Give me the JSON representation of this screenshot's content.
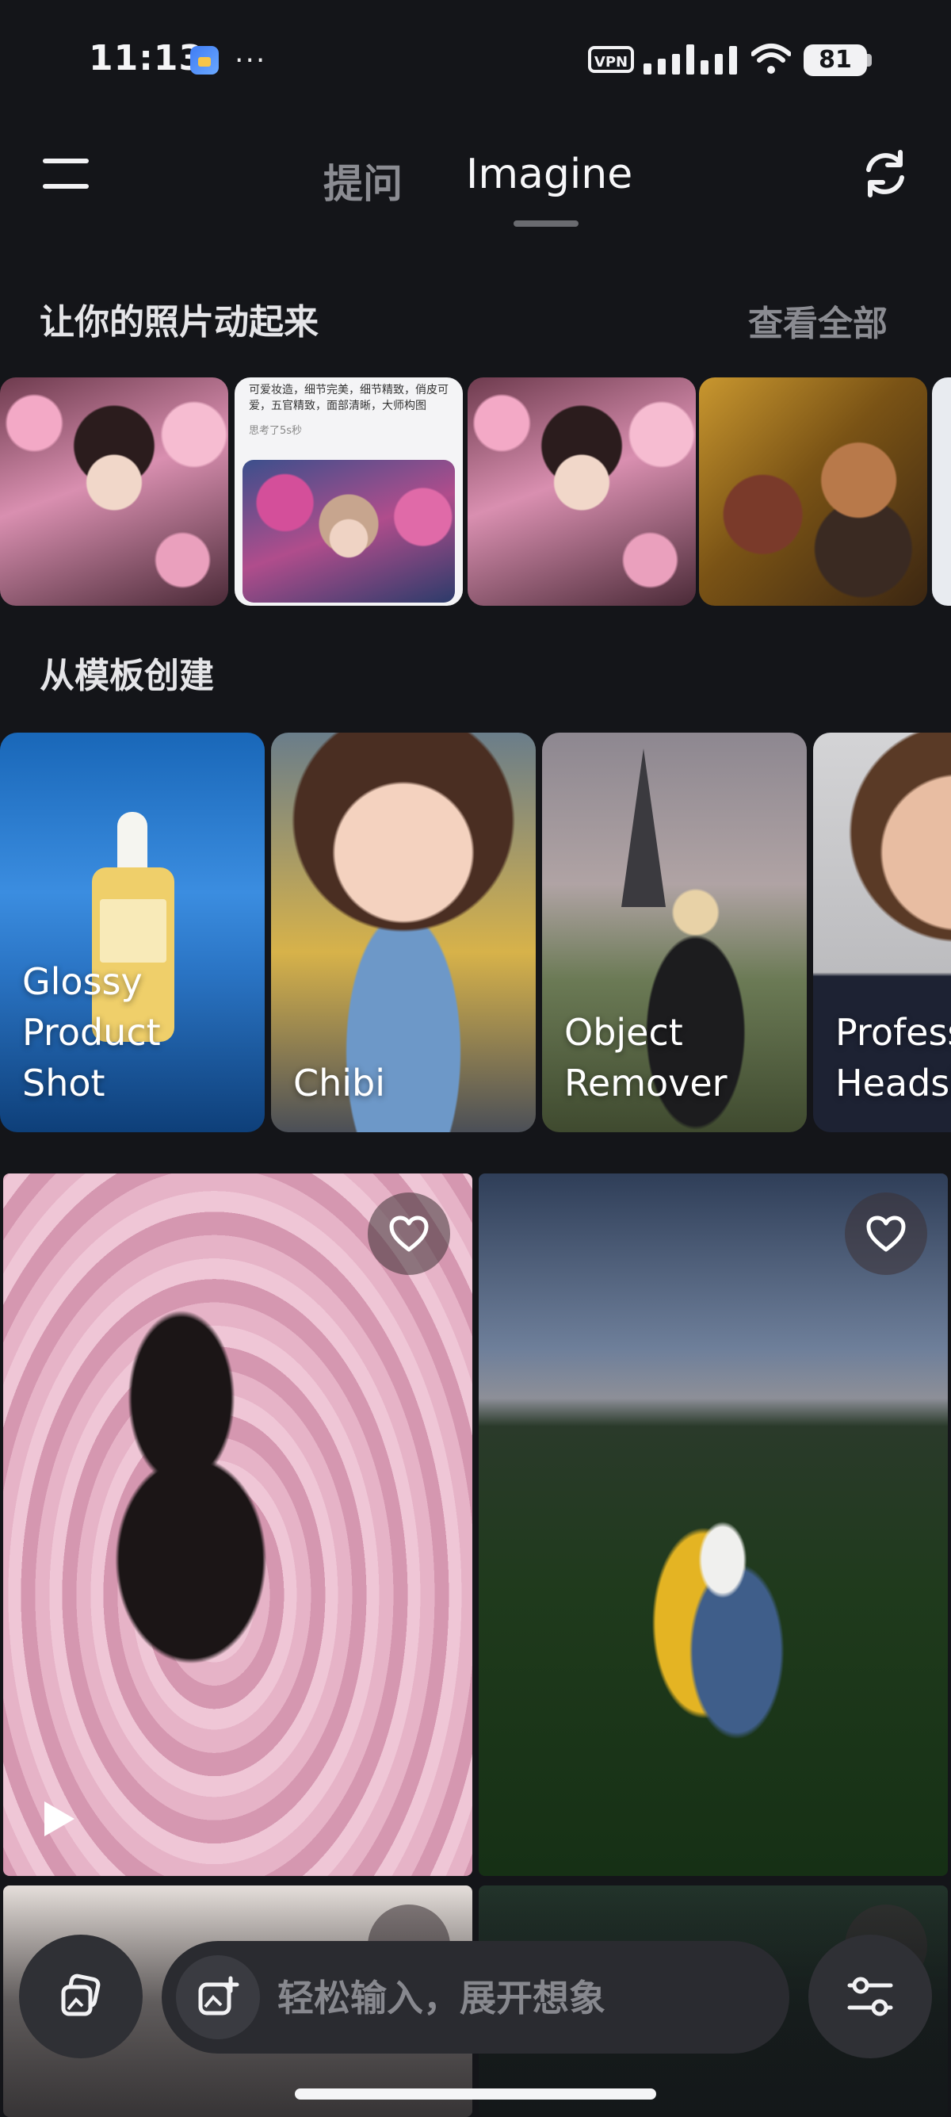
{
  "status_bar": {
    "time": "11:13",
    "dots": "···",
    "vpn": "VPN",
    "battery": "81"
  },
  "header": {
    "tabs": [
      {
        "label": "提问",
        "active": false
      },
      {
        "label": "Imagine",
        "active": true
      }
    ]
  },
  "animate_section": {
    "title": "让你的照片动起来",
    "see_all": "查看全部",
    "chat_thumb_text": "可爱妆造，细节完美，细节精致，俏皮可爱，五官精致，面部清晰，大师构图",
    "chat_thumb_thinking": "思考了5s秒"
  },
  "template_section": {
    "title": "从模板创建",
    "templates": [
      {
        "label": "Glossy Product Shot",
        "lines": [
          "Glossy",
          "Product",
          "Shot"
        ]
      },
      {
        "label": "Chibi",
        "lines": [
          "Chibi"
        ]
      },
      {
        "label": "Object Remover",
        "lines": [
          "Object",
          "Remover"
        ]
      },
      {
        "label": "Professional Headshot",
        "lines": [
          "Profess",
          "Headsh"
        ]
      }
    ]
  },
  "bottom_bar": {
    "prompt_placeholder": "轻松输入，展开想象"
  },
  "colors": {
    "background": "#141519",
    "accent_text": "#f7f7f9",
    "muted_text": "#8b8c92"
  }
}
